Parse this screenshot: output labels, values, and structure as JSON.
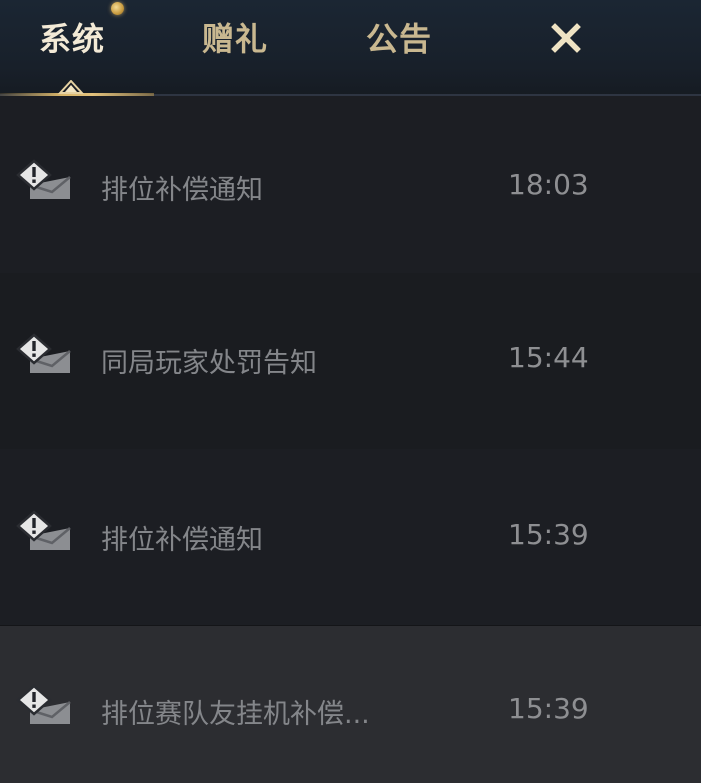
{
  "tabs": {
    "system": "系统",
    "gift": "赠礼",
    "notice": "公告"
  },
  "mails": [
    {
      "title": "排位补偿通知",
      "time": "18:03"
    },
    {
      "title": "同局玩家处罚告知",
      "time": "15:44"
    },
    {
      "title": "排位补偿通知",
      "time": "15:39"
    },
    {
      "title": "排位赛队友挂机补偿...",
      "time": "15:39"
    }
  ],
  "icons": {
    "mail": "warning-mail-icon",
    "close": "close-icon",
    "badge": "notification-dot-icon"
  },
  "colors": {
    "accent": "#d9b66a",
    "active_tab": "#f3ead6",
    "inactive_tab": "#c9b890",
    "row_text": "#84868a"
  }
}
